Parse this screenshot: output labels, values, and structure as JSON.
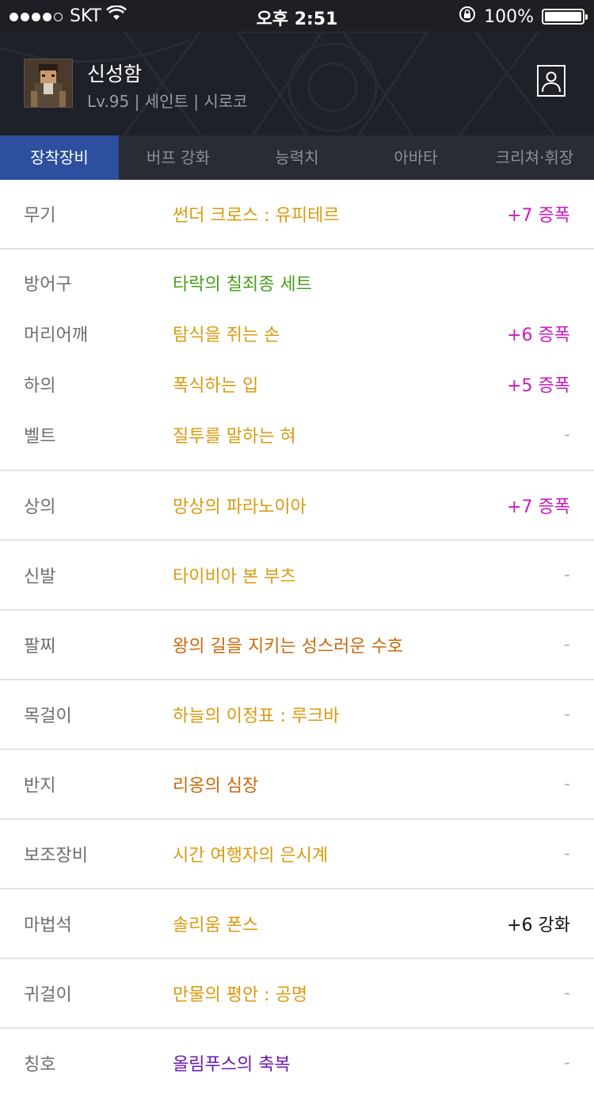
{
  "status_bar": {
    "carrier": "SKT",
    "time": "오후 2:51",
    "battery": "100%"
  },
  "profile": {
    "name": "신성함",
    "sub": "Lv.95 | 세인트 | 시로코"
  },
  "tabs": [
    {
      "label": "장착장비",
      "active": true
    },
    {
      "label": "버프 강화",
      "active": false
    },
    {
      "label": "능력치",
      "active": false
    },
    {
      "label": "아바타",
      "active": false
    },
    {
      "label": "크리쳐·휘장",
      "active": false
    }
  ],
  "equipment": {
    "weapon": {
      "slot": "무기",
      "item": "썬더 크로스 : 유피테르",
      "value": "+7 증폭"
    },
    "armor_set": {
      "slot": "방어구",
      "item": "타락의 칠죄종 세트"
    },
    "shoulder": {
      "slot": "머리어깨",
      "item": "탐식을 쥐는 손",
      "value": "+6 증폭"
    },
    "pants": {
      "slot": "하의",
      "item": "폭식하는 입",
      "value": "+5 증폭"
    },
    "belt": {
      "slot": "벨트",
      "item": "질투를 말하는 혀",
      "value": "-"
    },
    "top": {
      "slot": "상의",
      "item": "망상의 파라노이아",
      "value": "+7 증폭"
    },
    "shoes": {
      "slot": "신발",
      "item": "타이비아 본 부츠",
      "value": "-"
    },
    "bracelet": {
      "slot": "팔찌",
      "item": "왕의 길을 지키는 성스러운 수호",
      "value": "-"
    },
    "necklace": {
      "slot": "목걸이",
      "item": "하늘의 이정표 : 루크바",
      "value": "-"
    },
    "ring": {
      "slot": "반지",
      "item": "리옹의 심장",
      "value": "-"
    },
    "support": {
      "slot": "보조장비",
      "item": "시간 여행자의 은시계",
      "value": "-"
    },
    "magic_stone": {
      "slot": "마법석",
      "item": "솔리움 폰스",
      "value": "+6 강화"
    },
    "earring": {
      "slot": "귀걸이",
      "item": "만물의 평안 : 공명",
      "value": "-"
    },
    "title": {
      "slot": "칭호",
      "item": "올림푸스의 축복",
      "value": "-"
    }
  }
}
